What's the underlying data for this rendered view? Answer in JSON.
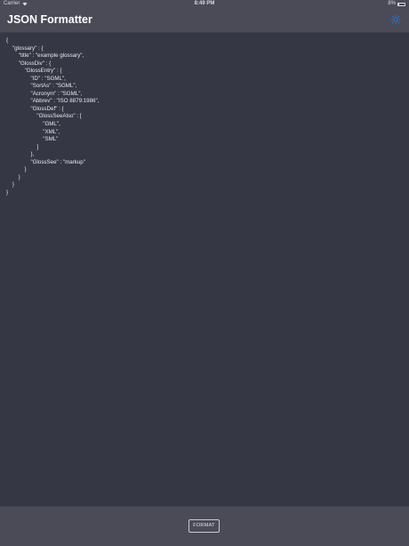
{
  "status_bar": {
    "carrier": "Carrier",
    "time": "8:49 PM",
    "battery_text": "8%",
    "battery_level": 0.08
  },
  "header": {
    "title": "JSON Formatter",
    "theme_icon": "sun-icon",
    "accent_color": "#2f7fd8"
  },
  "editor": {
    "content": "{\n\t\"glossary\" : {\n\t\t\"title\" : \"example glossary\",\n\t\t\"GlossDiv\" : {\n\t\t\t\"GlossEntry\" : {\n\t\t\t\t\"ID\" : \"SGML\",\n\t\t\t\t\"SortAs\" : \"SGML\",\n\t\t\t\t\"Acronym\" : \"SGML\",\n\t\t\t\t\"Abbrev\" : \"ISO 8879:1986\",\n\t\t\t\t\"GlossDef\" : {\n\t\t\t\t\t\"GlossSeeAlso\" : [\n\t\t\t\t\t\t\"GML\",\n\t\t\t\t\t\t\"XML\",\n\t\t\t\t\t\t\"SML\"\n\t\t\t\t\t]\n\t\t\t\t},\n\t\t\t\t\"GlossSee\" : \"markup\"\n\t\t\t}\n\t\t}\n\t}\n}"
  },
  "footer": {
    "format_label": "FORMAT"
  }
}
